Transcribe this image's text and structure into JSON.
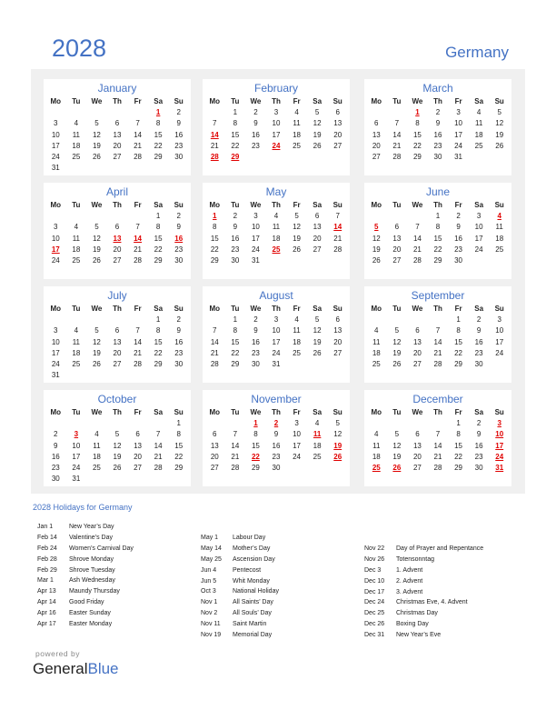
{
  "header": {
    "year": "2028",
    "country": "Germany"
  },
  "weekdays": [
    "Mo",
    "Tu",
    "We",
    "Th",
    "Fr",
    "Sa",
    "Su"
  ],
  "accent_color": "#4472c4",
  "holiday_color": "#e00000",
  "months": [
    {
      "name": "January",
      "offset": 5,
      "days": 31,
      "holidays": [
        1
      ]
    },
    {
      "name": "February",
      "offset": 1,
      "days": 29,
      "holidays": [
        14,
        24,
        28,
        29
      ]
    },
    {
      "name": "March",
      "offset": 2,
      "days": 31,
      "holidays": [
        1
      ]
    },
    {
      "name": "April",
      "offset": 5,
      "days": 30,
      "holidays": [
        13,
        14,
        16,
        17
      ]
    },
    {
      "name": "May",
      "offset": 0,
      "days": 31,
      "holidays": [
        1,
        14,
        25
      ]
    },
    {
      "name": "June",
      "offset": 3,
      "days": 30,
      "holidays": [
        4,
        5
      ]
    },
    {
      "name": "July",
      "offset": 5,
      "days": 31,
      "holidays": []
    },
    {
      "name": "August",
      "offset": 1,
      "days": 31,
      "holidays": []
    },
    {
      "name": "September",
      "offset": 4,
      "days": 30,
      "holidays": []
    },
    {
      "name": "October",
      "offset": 6,
      "days": 31,
      "holidays": [
        3
      ]
    },
    {
      "name": "November",
      "offset": 2,
      "days": 30,
      "holidays": [
        1,
        2,
        11,
        19,
        22,
        26
      ]
    },
    {
      "name": "December",
      "offset": 4,
      "days": 31,
      "holidays": [
        3,
        10,
        17,
        24,
        25,
        26,
        31
      ]
    }
  ],
  "holidays_section": {
    "title": "2028 Holidays for Germany",
    "columns": [
      [
        {
          "date": "Jan 1",
          "name": "New Year’s Day"
        },
        {
          "date": "Feb 14",
          "name": "Valentine’s Day"
        },
        {
          "date": "Feb 24",
          "name": "Women’s Carnival Day"
        },
        {
          "date": "Feb 28",
          "name": "Shrove Monday"
        },
        {
          "date": "Feb 29",
          "name": "Shrove Tuesday"
        },
        {
          "date": "Mar 1",
          "name": "Ash Wednesday"
        },
        {
          "date": "Apr 13",
          "name": "Maundy Thursday"
        },
        {
          "date": "Apr 14",
          "name": "Good Friday"
        },
        {
          "date": "Apr 16",
          "name": "Easter Sunday"
        },
        {
          "date": "Apr 17",
          "name": "Easter Monday"
        }
      ],
      [
        {
          "date": "May 1",
          "name": "Labour Day"
        },
        {
          "date": "May 14",
          "name": "Mother’s Day"
        },
        {
          "date": "May 25",
          "name": "Ascension Day"
        },
        {
          "date": "Jun 4",
          "name": "Pentecost"
        },
        {
          "date": "Jun 5",
          "name": "Whit Monday"
        },
        {
          "date": "Oct 3",
          "name": "National Holiday"
        },
        {
          "date": "Nov 1",
          "name": "All Saints’ Day"
        },
        {
          "date": "Nov 2",
          "name": "All Souls’ Day"
        },
        {
          "date": "Nov 11",
          "name": "Saint Martin"
        },
        {
          "date": "Nov 19",
          "name": "Memorial Day"
        }
      ],
      [
        {
          "date": "Nov 22",
          "name": "Day of Prayer and Repentance"
        },
        {
          "date": "Nov 26",
          "name": "Totensonntag"
        },
        {
          "date": "Dec 3",
          "name": "1. Advent"
        },
        {
          "date": "Dec 10",
          "name": "2. Advent"
        },
        {
          "date": "Dec 17",
          "name": "3. Advent"
        },
        {
          "date": "Dec 24",
          "name": "Christmas Eve, 4. Advent"
        },
        {
          "date": "Dec 25",
          "name": "Christmas Day"
        },
        {
          "date": "Dec 26",
          "name": "Boxing Day"
        },
        {
          "date": "Dec 31",
          "name": "New Year’s Eve"
        }
      ]
    ]
  },
  "footer": {
    "powered_by": "powered by",
    "brand_part1": "General",
    "brand_part2": "Blue"
  }
}
